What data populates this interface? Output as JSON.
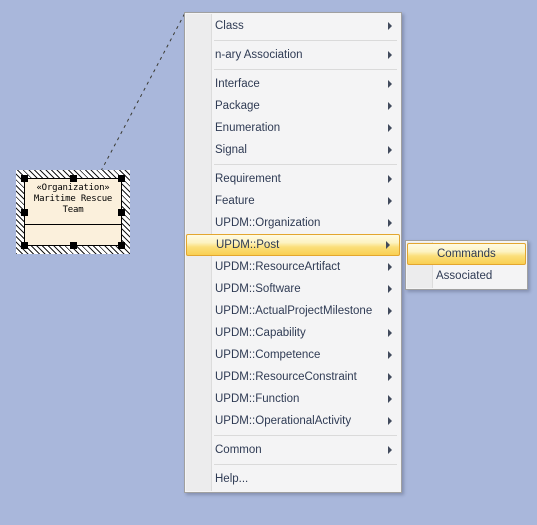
{
  "canvas": {
    "background_color": "#a9b7db",
    "shape": {
      "stereotype": "«Organization»",
      "name_line1": "Maritime Rescue",
      "name_line2": "Team",
      "fill_color": "#fbf0dc",
      "selected": true
    }
  },
  "context_menu": {
    "items": [
      {
        "label": "Class",
        "submenu": true,
        "selected": false,
        "separator_after": true
      },
      {
        "label": "n-ary Association",
        "submenu": true,
        "selected": false,
        "separator_after": true
      },
      {
        "label": "Interface",
        "submenu": true,
        "selected": false,
        "separator_after": false
      },
      {
        "label": "Package",
        "submenu": true,
        "selected": false,
        "separator_after": false
      },
      {
        "label": "Enumeration",
        "submenu": true,
        "selected": false,
        "separator_after": false
      },
      {
        "label": "Signal",
        "submenu": true,
        "selected": false,
        "separator_after": true
      },
      {
        "label": "Requirement",
        "submenu": true,
        "selected": false,
        "separator_after": false
      },
      {
        "label": "Feature",
        "submenu": true,
        "selected": false,
        "separator_after": false
      },
      {
        "label": "UPDM::Organization",
        "submenu": true,
        "selected": false,
        "separator_after": false
      },
      {
        "label": "UPDM::Post",
        "submenu": true,
        "selected": true,
        "separator_after": false
      },
      {
        "label": "UPDM::ResourceArtifact",
        "submenu": true,
        "selected": false,
        "separator_after": false
      },
      {
        "label": "UPDM::Software",
        "submenu": true,
        "selected": false,
        "separator_after": false
      },
      {
        "label": "UPDM::ActualProjectMilestone",
        "submenu": true,
        "selected": false,
        "separator_after": false
      },
      {
        "label": "UPDM::Capability",
        "submenu": true,
        "selected": false,
        "separator_after": false
      },
      {
        "label": "UPDM::Competence",
        "submenu": true,
        "selected": false,
        "separator_after": false
      },
      {
        "label": "UPDM::ResourceConstraint",
        "submenu": true,
        "selected": false,
        "separator_after": false
      },
      {
        "label": "UPDM::Function",
        "submenu": true,
        "selected": false,
        "separator_after": false
      },
      {
        "label": "UPDM::OperationalActivity",
        "submenu": true,
        "selected": false,
        "separator_after": true
      },
      {
        "label": "Common",
        "submenu": true,
        "selected": false,
        "separator_after": true
      },
      {
        "label": "Help...",
        "submenu": false,
        "selected": false,
        "separator_after": false
      }
    ],
    "highlight_color": "#f9cf52",
    "text_color": "#2f3b54"
  },
  "submenu": {
    "items": [
      {
        "label": "Commands",
        "submenu": false,
        "selected": true
      },
      {
        "label": "Associated",
        "submenu": false,
        "selected": false
      }
    ]
  }
}
